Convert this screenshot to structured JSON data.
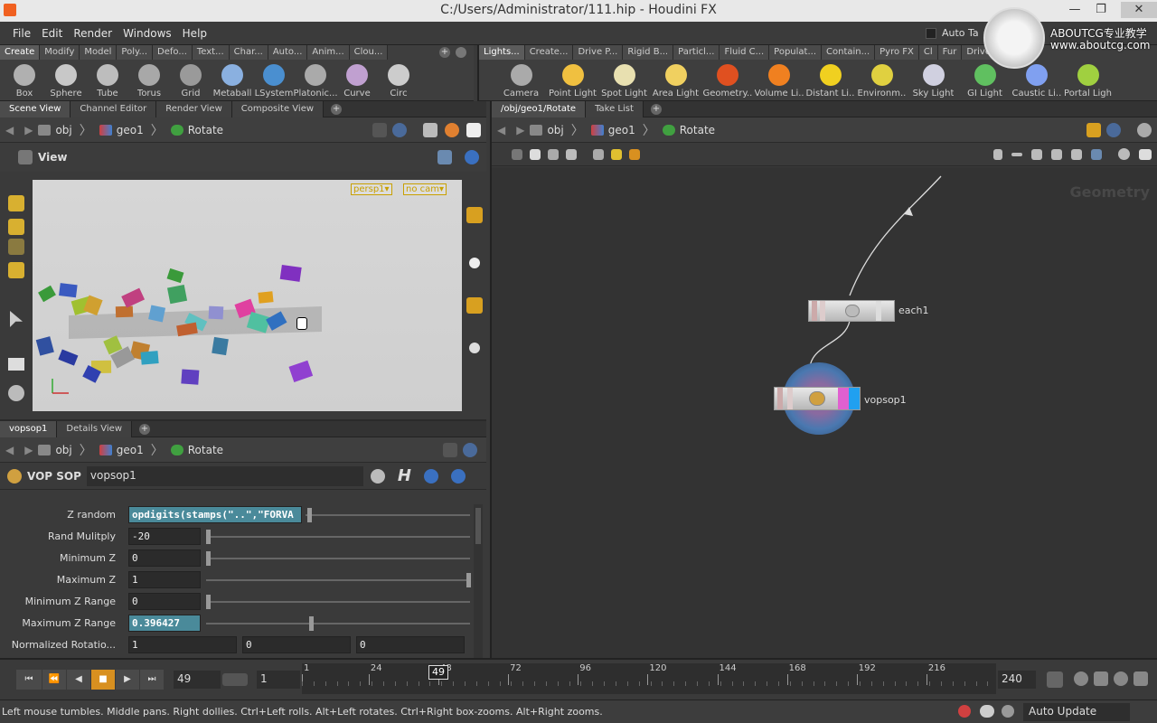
{
  "window": {
    "title": "C:/Users/Administrator/111.hip - Houdini FX",
    "controls": [
      "—",
      "❐",
      "✕"
    ]
  },
  "menu": [
    "File",
    "Edit",
    "Render",
    "Windows",
    "Help"
  ],
  "auto_tab": "Auto Ta",
  "watermark": {
    "line1": "ABOUTCG专业教学",
    "line2": "www.aboutcg.com"
  },
  "shelf_left": {
    "tabs": [
      "Create",
      "Modify",
      "Model",
      "Poly...",
      "Defo...",
      "Text...",
      "Char...",
      "Auto...",
      "Anim...",
      "Clou..."
    ],
    "tools": [
      {
        "label": "Box",
        "icon": "box-icon",
        "color": "#b0b0b0"
      },
      {
        "label": "Sphere",
        "icon": "sphere-icon",
        "color": "#c8c8c8"
      },
      {
        "label": "Tube",
        "icon": "tube-icon",
        "color": "#bdbdbd"
      },
      {
        "label": "Torus",
        "icon": "torus-icon",
        "color": "#a8a8a8"
      },
      {
        "label": "Grid",
        "icon": "grid-icon",
        "color": "#9a9a9a"
      },
      {
        "label": "Metaball",
        "icon": "metaball-icon",
        "color": "#8ab0e0"
      },
      {
        "label": "LSystem",
        "icon": "lsystem-icon",
        "color": "#4a8fd0"
      },
      {
        "label": "Platonic...",
        "icon": "platonic-icon",
        "color": "#aaaaaa"
      },
      {
        "label": "Curve",
        "icon": "curve-icon",
        "color": "#c0a0d0"
      },
      {
        "label": "Circ",
        "icon": "circle-icon",
        "color": "#cccccc"
      }
    ]
  },
  "shelf_right": {
    "tabs": [
      "Lights...",
      "Create...",
      "Drive P...",
      "Rigid B...",
      "Particl...",
      "Fluid C...",
      "Populat...",
      "Contain...",
      "Pyro FX",
      "Cl",
      "Fur",
      "Drive S..."
    ],
    "tools": [
      {
        "label": "Camera",
        "icon": "camera-icon",
        "color": "#aaaaaa"
      },
      {
        "label": "Point Light",
        "icon": "point-light-icon",
        "color": "#f0c040"
      },
      {
        "label": "Spot Light",
        "icon": "spot-light-icon",
        "color": "#e8e0b0"
      },
      {
        "label": "Area Light",
        "icon": "area-light-icon",
        "color": "#f0d060"
      },
      {
        "label": "Geometry...",
        "icon": "geometry-light-icon",
        "color": "#e05020"
      },
      {
        "label": "Volume Li...",
        "icon": "volume-light-icon",
        "color": "#f08020"
      },
      {
        "label": "Distant Li...",
        "icon": "distant-light-icon",
        "color": "#f0d020"
      },
      {
        "label": "Environm...",
        "icon": "environment-light-icon",
        "color": "#e0d040"
      },
      {
        "label": "Sky Light",
        "icon": "sky-light-icon",
        "color": "#d0d0e0"
      },
      {
        "label": "GI Light",
        "icon": "gi-light-icon",
        "color": "#60c060"
      },
      {
        "label": "Caustic Li...",
        "icon": "caustic-light-icon",
        "color": "#80a0f0"
      },
      {
        "label": "Portal Ligh",
        "icon": "portal-light-icon",
        "color": "#a0d040"
      }
    ]
  },
  "scene_pane": {
    "tabs": [
      "Scene View",
      "Channel Editor",
      "Render View",
      "Composite View"
    ],
    "path": [
      "obj",
      "geo1",
      "Rotate"
    ],
    "view_label": "View",
    "camera_menu": "persp1▾",
    "cam_menu": "no cam▾"
  },
  "param_pane": {
    "tabs": [
      "vopsop1",
      "Details View"
    ],
    "path": [
      "obj",
      "geo1",
      "Rotate"
    ],
    "node_type": "VOP SOP",
    "node_name": "vopsop1",
    "params": [
      {
        "label": "Z random",
        "value": "opdigits(stamps(\"..\",\"FORVA",
        "slider": 0.01,
        "highlight": true
      },
      {
        "label": "Rand Mulitply",
        "value": "-20",
        "slider": 0.0,
        "highlight": false
      },
      {
        "label": "Minimum Z",
        "value": "0",
        "slider": 0.0,
        "highlight": false
      },
      {
        "label": "Maximum Z",
        "value": "1",
        "slider": 1.0,
        "highlight": false
      },
      {
        "label": "Minimum Z Range",
        "value": "0",
        "slider": 0.0,
        "highlight": false
      },
      {
        "label": "Maximum Z Range",
        "value": "0.396427",
        "slider": 0.396,
        "highlight": true
      }
    ],
    "norm_rot": {
      "label": "Normalized Rotatio...",
      "values": [
        "1",
        "0",
        "0"
      ]
    }
  },
  "network_pane": {
    "tabs": [
      "/obj/geo1/Rotate",
      "Take List"
    ],
    "path": [
      "obj",
      "geo1",
      "Rotate"
    ],
    "watermark_text": "Geometry",
    "nodes": [
      {
        "name": "each1"
      },
      {
        "name": "vopsop1"
      }
    ]
  },
  "timeline": {
    "current_frame": "49",
    "start_frame": "1",
    "end_frame": "240",
    "ticks": [
      "1",
      "24",
      "48",
      "72",
      "96",
      "120",
      "144",
      "168",
      "192",
      "216"
    ],
    "frame_marker": "49"
  },
  "status": {
    "text": "Left mouse tumbles. Middle pans. Right dollies. Ctrl+Left rolls. Alt+Left rotates. Ctrl+Right box-zooms. Alt+Right zooms.",
    "auto_update": "Auto Update"
  }
}
